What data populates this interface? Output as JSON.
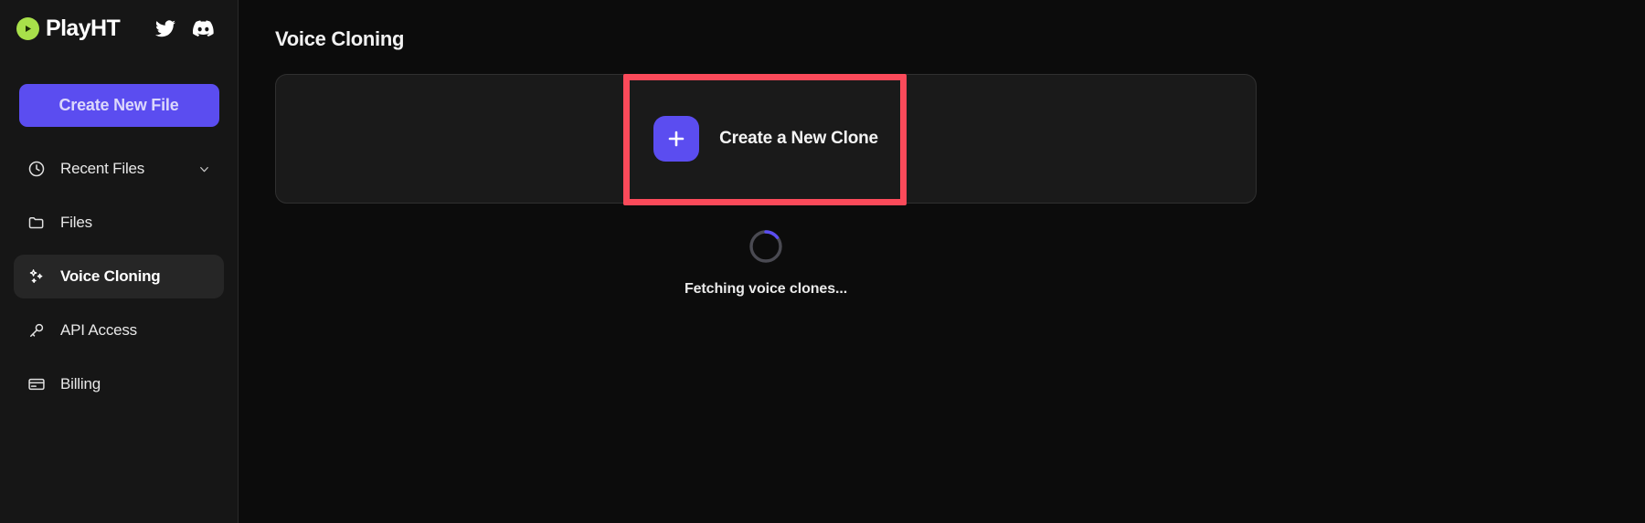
{
  "brand": {
    "name": "PlayHT",
    "logo_icon": "play-circle-icon",
    "logo_color": "#a8e04a",
    "social": [
      {
        "icon": "twitter-icon",
        "label": "Twitter"
      },
      {
        "icon": "discord-icon",
        "label": "Discord"
      }
    ]
  },
  "sidebar": {
    "create_file_label": "Create New File",
    "accent_color": "#5b4df0",
    "items": [
      {
        "label": "Recent Files",
        "icon": "clock-icon",
        "active": false,
        "has_chevron": true,
        "chevron_icon": "chevron-down-icon"
      },
      {
        "label": "Files",
        "icon": "folder-icon",
        "active": false,
        "has_chevron": false
      },
      {
        "label": "Voice Cloning",
        "icon": "sparkles-icon",
        "active": true,
        "has_chevron": false
      },
      {
        "label": "API Access",
        "icon": "key-icon",
        "active": false,
        "has_chevron": false
      },
      {
        "label": "Billing",
        "icon": "credit-card-icon",
        "active": false,
        "has_chevron": false
      }
    ]
  },
  "main": {
    "page_title": "Voice Cloning",
    "clone_card": {
      "plus_icon": "plus-icon",
      "create_clone_label": "Create a New Clone",
      "tile_color": "#5b4df0"
    },
    "highlight": {
      "color": "#fb4a5a",
      "target": "create-a-new-clone-button"
    },
    "loading": {
      "spinner_icon": "loading-spinner-icon",
      "spinner_track_color": "#4a4a52",
      "spinner_arc_color": "#5b4df0",
      "text": "Fetching voice clones..."
    }
  }
}
